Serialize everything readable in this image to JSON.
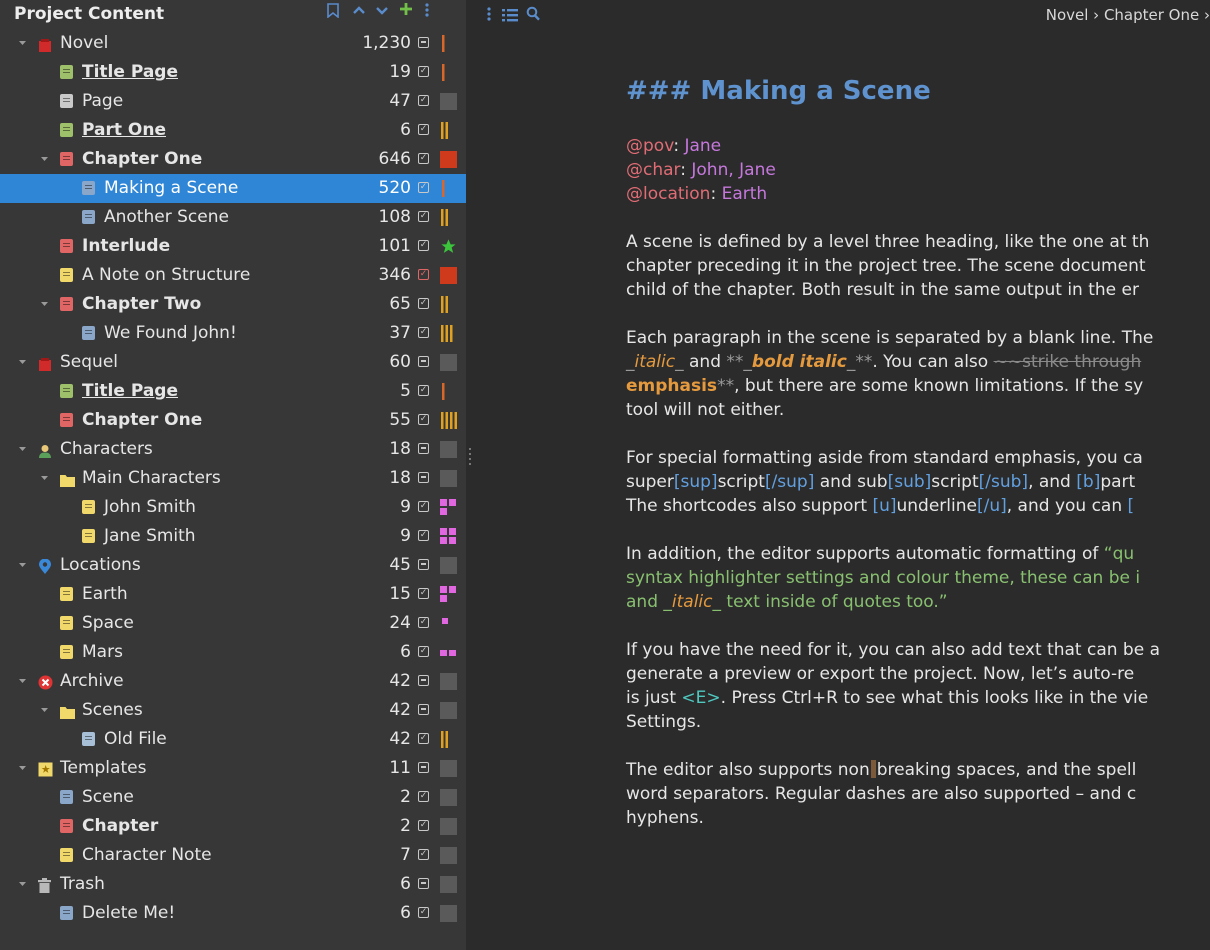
{
  "sidebar": {
    "title": "Project Content",
    "header_icons": [
      "bookmark-icon",
      "chevron-up-icon",
      "chevron-down-icon",
      "add-icon",
      "more-vertical-icon"
    ],
    "items": [
      {
        "label": "Novel",
        "count": "1,230",
        "level": 0,
        "expand": "open",
        "icon": "novel-root",
        "bold": false,
        "underline": false,
        "status": "dash",
        "marker": "bar1"
      },
      {
        "label": "Title Page",
        "count": "19",
        "level": 1,
        "icon": "doc-green",
        "bold": true,
        "underline": true,
        "status": "check",
        "marker": "bar1"
      },
      {
        "label": "Page",
        "count": "47",
        "level": 1,
        "icon": "doc-grey",
        "bold": false,
        "underline": false,
        "status": "check",
        "marker": "grey"
      },
      {
        "label": "Part One",
        "count": "6",
        "level": 1,
        "icon": "doc-green",
        "bold": true,
        "underline": true,
        "status": "check",
        "marker": "bar2"
      },
      {
        "label": "Chapter One",
        "count": "646",
        "level": 1,
        "expand": "open",
        "icon": "doc-red",
        "bold": true,
        "underline": false,
        "status": "check",
        "marker": "red"
      },
      {
        "label": "Making a Scene",
        "count": "520",
        "level": 2,
        "icon": "doc-blue",
        "bold": false,
        "underline": false,
        "status": "check",
        "marker": "bar1",
        "selected": true
      },
      {
        "label": "Another Scene",
        "count": "108",
        "level": 2,
        "icon": "doc-blue",
        "bold": false,
        "underline": false,
        "status": "check",
        "marker": "bar2"
      },
      {
        "label": "Interlude",
        "count": "101",
        "level": 1,
        "icon": "doc-red",
        "bold": true,
        "underline": false,
        "status": "check",
        "marker": "star"
      },
      {
        "label": "A Note on Structure",
        "count": "346",
        "level": 1,
        "icon": "doc-yellow",
        "bold": false,
        "underline": false,
        "status": "check-red",
        "marker": "red"
      },
      {
        "label": "Chapter Two",
        "count": "65",
        "level": 1,
        "expand": "open",
        "icon": "doc-red",
        "bold": true,
        "underline": false,
        "status": "check",
        "marker": "bar2"
      },
      {
        "label": "We Found John!",
        "count": "37",
        "level": 2,
        "icon": "doc-blue",
        "bold": false,
        "underline": false,
        "status": "check",
        "marker": "bar3"
      },
      {
        "label": "Sequel",
        "count": "60",
        "level": 0,
        "expand": "open",
        "icon": "novel-root",
        "bold": false,
        "underline": false,
        "status": "dash",
        "marker": "grey"
      },
      {
        "label": "Title Page",
        "count": "5",
        "level": 1,
        "icon": "doc-green",
        "bold": true,
        "underline": true,
        "status": "check",
        "marker": "bar1"
      },
      {
        "label": "Chapter One",
        "count": "55",
        "level": 1,
        "icon": "doc-red",
        "bold": true,
        "underline": false,
        "status": "check",
        "marker": "bar4"
      },
      {
        "label": "Characters",
        "count": "18",
        "level": 0,
        "expand": "open",
        "icon": "person-root",
        "bold": false,
        "underline": false,
        "status": "dash",
        "marker": "grey"
      },
      {
        "label": "Main Characters",
        "count": "18",
        "level": 1,
        "expand": "open",
        "icon": "folder",
        "bold": false,
        "underline": false,
        "status": "dash",
        "marker": "grey"
      },
      {
        "label": "John Smith",
        "count": "9",
        "level": 2,
        "icon": "doc-yellow",
        "bold": false,
        "underline": false,
        "status": "check",
        "marker": "pink3"
      },
      {
        "label": "Jane Smith",
        "count": "9",
        "level": 2,
        "icon": "doc-yellow",
        "bold": false,
        "underline": false,
        "status": "check",
        "marker": "pink4"
      },
      {
        "label": "Locations",
        "count": "45",
        "level": 0,
        "expand": "open",
        "icon": "pin-root",
        "bold": false,
        "underline": false,
        "status": "dash",
        "marker": "grey"
      },
      {
        "label": "Earth",
        "count": "15",
        "level": 1,
        "icon": "doc-yellow",
        "bold": false,
        "underline": false,
        "status": "check",
        "marker": "pink3"
      },
      {
        "label": "Space",
        "count": "24",
        "level": 1,
        "icon": "doc-yellow",
        "bold": false,
        "underline": false,
        "status": "check",
        "marker": "pink1"
      },
      {
        "label": "Mars",
        "count": "6",
        "level": 1,
        "icon": "doc-yellow",
        "bold": false,
        "underline": false,
        "status": "check",
        "marker": "pink2"
      },
      {
        "label": "Archive",
        "count": "42",
        "level": 0,
        "expand": "open",
        "icon": "archive-root",
        "bold": false,
        "underline": false,
        "status": "dash",
        "marker": "grey"
      },
      {
        "label": "Scenes",
        "count": "42",
        "level": 1,
        "expand": "open",
        "icon": "folder",
        "bold": false,
        "underline": false,
        "status": "dash",
        "marker": "grey"
      },
      {
        "label": "Old File",
        "count": "42",
        "level": 2,
        "icon": "doc-lblue",
        "bold": false,
        "underline": false,
        "status": "check",
        "marker": "bar2"
      },
      {
        "label": "Templates",
        "count": "11",
        "level": 0,
        "expand": "open",
        "icon": "template-root",
        "bold": false,
        "underline": false,
        "status": "dash",
        "marker": "grey"
      },
      {
        "label": "Scene",
        "count": "2",
        "level": 1,
        "icon": "doc-blue",
        "bold": false,
        "underline": false,
        "status": "check",
        "marker": "grey"
      },
      {
        "label": "Chapter",
        "count": "2",
        "level": 1,
        "icon": "doc-red",
        "bold": true,
        "underline": false,
        "status": "check",
        "marker": "grey"
      },
      {
        "label": "Character Note",
        "count": "7",
        "level": 1,
        "icon": "doc-yellow",
        "bold": false,
        "underline": false,
        "status": "check",
        "marker": "grey"
      },
      {
        "label": "Trash",
        "count": "6",
        "level": 0,
        "expand": "open",
        "icon": "trash-root",
        "bold": false,
        "underline": false,
        "status": "dash",
        "marker": "grey"
      },
      {
        "label": "Delete Me!",
        "count": "6",
        "level": 1,
        "icon": "doc-blue",
        "bold": false,
        "underline": false,
        "status": "check",
        "marker": "grey"
      }
    ]
  },
  "editor": {
    "toolbar_icons": [
      "more-vertical-icon",
      "outline-list-icon",
      "search-icon"
    ],
    "breadcrumb": "Novel › Chapter One ›",
    "heading": "### Making a Scene",
    "meta": [
      {
        "key": "@pov",
        "value": "Jane"
      },
      {
        "key": "@char",
        "value": "John, Jane"
      },
      {
        "key": "@location",
        "value": "Earth"
      }
    ],
    "p1": [
      "A scene is defined by a level three heading, like the one at th",
      "chapter preceding it in the project tree. The scene document",
      "child of the chapter. Both result in the same output in the er"
    ],
    "p2": {
      "l1": "Each paragraph in the scene is separated by a blank line. The",
      "l2a": "_",
      "l2b": "italic",
      "l2c": "_",
      "l2d": " and ",
      "l2e": "**_",
      "l2f": "bold italic",
      "l2g": "_**",
      "l2h": ". You can also ",
      "l2i": "~~strike through",
      "l3a": "emphasis",
      "l3b": "**",
      "l3c": ", but there are some known limitations. If the sy",
      "l4": "tool will not either."
    },
    "p3": {
      "l1": "For special formatting aside from standard emphasis, you ca",
      "l2a": "super",
      "l2b": "[sup]",
      "l2c": "script",
      "l2d": "[/sup]",
      "l2e": " and sub",
      "l2f": "[sub]",
      "l2g": "script",
      "l2h": "[/sub]",
      "l2i": ", and ",
      "l2j": "[b]",
      "l2k": "part",
      "l3a": "The shortcodes also support ",
      "l3b": "[u]",
      "l3c": "underline",
      "l3d": "[/u]",
      "l3e": ", and you can ",
      "l3f": "["
    },
    "p4": {
      "l1a": "In addition, the editor supports automatic formatting of ",
      "l1b": "“qu",
      "l2": "syntax highlighter settings and colour theme, these can be i",
      "l3a": "and _",
      "l3b": "italic",
      "l3c": "_ text inside of quotes too.”"
    },
    "p5": [
      "If you have the need for it, you can also add text that can be a",
      "generate a preview or export the project. Now, let’s auto-re",
      "is just <E>. Press Ctrl+R to see what this looks like in the vie",
      "Settings."
    ],
    "p5_tag": "<E>",
    "p6": {
      "l1a": "The editor also supports non",
      "l1b": "breaking spaces, and the spell",
      "l2": "word separators. Regular dashes are also supported – and c",
      "l3": "hyphens."
    },
    "colors": {
      "heading": "#5f93cf",
      "keyword": "#e06c75",
      "value": "#c678dd",
      "shortcode": "#62a0e0",
      "quote": "#88c070",
      "emphasis": "#e59a3e"
    }
  }
}
